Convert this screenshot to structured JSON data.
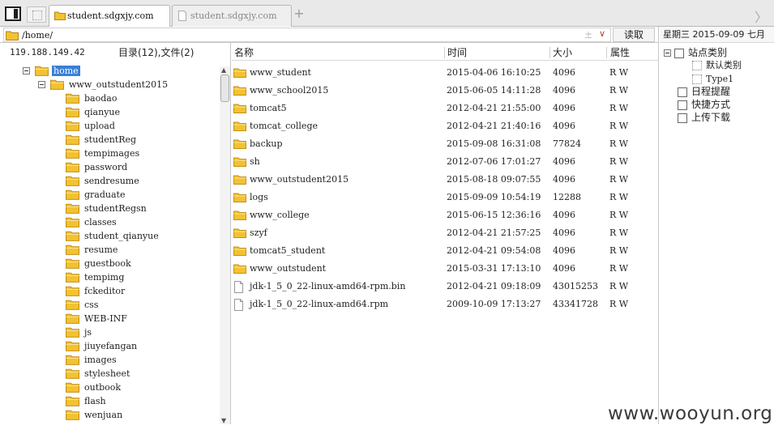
{
  "tabs": [
    {
      "label": "student.sdgxjy.com",
      "active": true
    },
    {
      "label": "student.sdgxjy.com",
      "active": false
    }
  ],
  "tab_new_symbol": "+",
  "tab_scroll_symbol": "〉",
  "address": {
    "value": "/home/",
    "read_button": "读取",
    "add_symbol": "±",
    "dropdown_symbol": "∨"
  },
  "left_panel": {
    "ip": "119.188.149.42",
    "counts": "目录(12),文件(2)",
    "tree": [
      {
        "label": "home",
        "level": 0,
        "expanded": true,
        "selected": true
      },
      {
        "label": "www_outstudent2015",
        "level": 1,
        "expanded": true,
        "selected": false
      },
      {
        "label": "baodao",
        "level": 2
      },
      {
        "label": "qianyue",
        "level": 2
      },
      {
        "label": "upload",
        "level": 2
      },
      {
        "label": "studentReg",
        "level": 2
      },
      {
        "label": "tempimages",
        "level": 2
      },
      {
        "label": "password",
        "level": 2
      },
      {
        "label": "sendresume",
        "level": 2
      },
      {
        "label": "graduate",
        "level": 2
      },
      {
        "label": "studentRegsn",
        "level": 2
      },
      {
        "label": "classes",
        "level": 2
      },
      {
        "label": "student_qianyue",
        "level": 2
      },
      {
        "label": "resume",
        "level": 2
      },
      {
        "label": "guestbook",
        "level": 2
      },
      {
        "label": "tempimg",
        "level": 2
      },
      {
        "label": "fckeditor",
        "level": 2
      },
      {
        "label": "css",
        "level": 2
      },
      {
        "label": "WEB-INF",
        "level": 2
      },
      {
        "label": "js",
        "level": 2
      },
      {
        "label": "jiuyefangan",
        "level": 2
      },
      {
        "label": "images",
        "level": 2
      },
      {
        "label": "stylesheet",
        "level": 2
      },
      {
        "label": "outbook",
        "level": 2
      },
      {
        "label": "flash",
        "level": 2
      },
      {
        "label": "wenjuan",
        "level": 2
      }
    ]
  },
  "file_list": {
    "columns": {
      "name": "名称",
      "time": "时间",
      "size": "大小",
      "attr": "属性"
    },
    "rows": [
      {
        "type": "folder",
        "name": "www_student",
        "time": "2015-04-06 16:10:25",
        "size": "4096",
        "attr": "R W"
      },
      {
        "type": "folder",
        "name": "www_school2015",
        "time": "2015-06-05 14:11:28",
        "size": "4096",
        "attr": "R W"
      },
      {
        "type": "folder",
        "name": "tomcat5",
        "time": "2012-04-21 21:55:00",
        "size": "4096",
        "attr": "R W"
      },
      {
        "type": "folder",
        "name": "tomcat_college",
        "time": "2012-04-21 21:40:16",
        "size": "4096",
        "attr": "R W"
      },
      {
        "type": "folder",
        "name": "backup",
        "time": "2015-09-08 16:31:08",
        "size": "77824",
        "attr": "R W"
      },
      {
        "type": "folder",
        "name": "sh",
        "time": "2012-07-06 17:01:27",
        "size": "4096",
        "attr": "R W"
      },
      {
        "type": "folder",
        "name": "www_outstudent2015",
        "time": "2015-08-18 09:07:55",
        "size": "4096",
        "attr": "R W"
      },
      {
        "type": "folder",
        "name": "logs",
        "time": "2015-09-09 10:54:19",
        "size": "12288",
        "attr": "R W"
      },
      {
        "type": "folder",
        "name": "www_college",
        "time": "2015-06-15 12:36:16",
        "size": "4096",
        "attr": "R W"
      },
      {
        "type": "folder",
        "name": "szyf",
        "time": "2012-04-21 21:57:25",
        "size": "4096",
        "attr": "R W"
      },
      {
        "type": "folder",
        "name": "tomcat5_student",
        "time": "2012-04-21 09:54:08",
        "size": "4096",
        "attr": "R W"
      },
      {
        "type": "folder",
        "name": "www_outstudent",
        "time": "2015-03-31 17:13:10",
        "size": "4096",
        "attr": "R W"
      },
      {
        "type": "file",
        "name": "jdk-1_5_0_22-linux-amd64-rpm.bin",
        "time": "2012-04-21 09:18:09",
        "size": "43015253",
        "attr": "R W"
      },
      {
        "type": "file",
        "name": "jdk-1_5_0_22-linux-amd64.rpm",
        "time": "2009-10-09 17:13:27",
        "size": "43341728",
        "attr": "R W"
      }
    ]
  },
  "right_panel": {
    "date_header": "星期三  2015-09-09  七月",
    "items": [
      {
        "label": "站点类别",
        "kind": "group"
      },
      {
        "label": "默认类别",
        "kind": "sub"
      },
      {
        "label": "Type1",
        "kind": "sub"
      },
      {
        "label": "日程提醒",
        "kind": "item",
        "icon": "clock-icon"
      },
      {
        "label": "快捷方式",
        "kind": "item",
        "icon": "shortcut-icon"
      },
      {
        "label": "上传下载",
        "kind": "item",
        "icon": "transfer-icon"
      }
    ]
  },
  "watermark": "www.wooyun.org",
  "colors": {
    "folder": "#f2c230",
    "folder_dark": "#c4901a",
    "selection": "#3a7fd6"
  }
}
